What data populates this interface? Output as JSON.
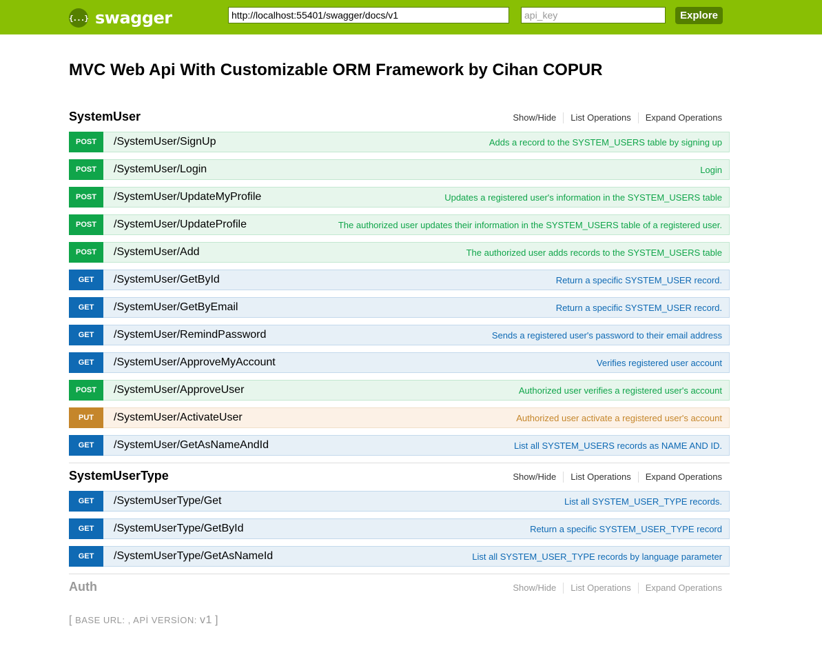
{
  "header": {
    "logo_icon": "{...}",
    "logo_text": "swagger",
    "url_value": "http://localhost:55401/swagger/docs/v1",
    "api_key_placeholder": "api_key",
    "explore_label": "Explore",
    "brand_color": "#89bf04"
  },
  "title": "MVC Web Api With Customizable ORM Framework by Cihan COPUR",
  "options": {
    "show_hide": "Show/Hide",
    "list_operations": "List Operations",
    "expand_operations": "Expand Operations"
  },
  "resources": [
    {
      "name": "SystemUser",
      "operations": [
        {
          "method": "POST",
          "path": "/SystemUser/SignUp",
          "summary": "Adds a record to the SYSTEM_USERS table by signing up"
        },
        {
          "method": "POST",
          "path": "/SystemUser/Login",
          "summary": "Login"
        },
        {
          "method": "POST",
          "path": "/SystemUser/UpdateMyProfile",
          "summary": "Updates a registered user's information in the SYSTEM_USERS table"
        },
        {
          "method": "POST",
          "path": "/SystemUser/UpdateProfile",
          "summary": "The authorized user updates their information in the SYSTEM_USERS table of a registered user."
        },
        {
          "method": "POST",
          "path": "/SystemUser/Add",
          "summary": "The authorized user adds records to the SYSTEM_USERS table"
        },
        {
          "method": "GET",
          "path": "/SystemUser/GetById",
          "summary": "Return a specific SYSTEM_USER record."
        },
        {
          "method": "GET",
          "path": "/SystemUser/GetByEmail",
          "summary": "Return a specific SYSTEM_USER record."
        },
        {
          "method": "GET",
          "path": "/SystemUser/RemindPassword",
          "summary": "Sends a registered user's password to their email address"
        },
        {
          "method": "GET",
          "path": "/SystemUser/ApproveMyAccount",
          "summary": "Verifies registered user account"
        },
        {
          "method": "POST",
          "path": "/SystemUser/ApproveUser",
          "summary": "Authorized user verifies a registered user's account"
        },
        {
          "method": "PUT",
          "path": "/SystemUser/ActivateUser",
          "summary": "Authorized user activate a registered user's account"
        },
        {
          "method": "GET",
          "path": "/SystemUser/GetAsNameAndId",
          "summary": "List all SYSTEM_USERS records as NAME AND ID."
        }
      ]
    },
    {
      "name": "SystemUserType",
      "operations": [
        {
          "method": "GET",
          "path": "/SystemUserType/Get",
          "summary": "List all SYSTEM_USER_TYPE records."
        },
        {
          "method": "GET",
          "path": "/SystemUserType/GetById",
          "summary": "Return a specific SYSTEM_USER_TYPE record"
        },
        {
          "method": "GET",
          "path": "/SystemUserType/GetAsNameId",
          "summary": "List all SYSTEM_USER_TYPE records by language parameter"
        }
      ]
    },
    {
      "name": "Auth",
      "operations": []
    }
  ],
  "footer": {
    "open_bracket": "[",
    "base_url_label": "BASE URL:",
    "separator": ",",
    "api_version_label": "APİ VERSİON:",
    "api_version_value": "v1",
    "close_bracket": "]"
  }
}
